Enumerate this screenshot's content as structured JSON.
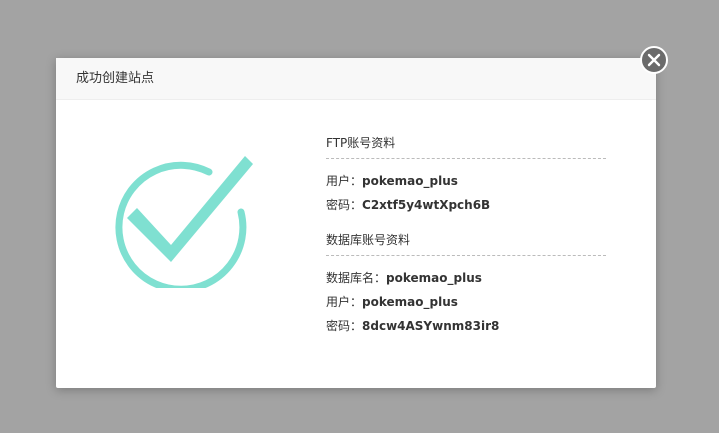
{
  "dialog": {
    "title": "成功创建站点",
    "close_icon": "close-icon"
  },
  "success_icon": {
    "name": "checkmark-circle-icon",
    "color": "#7fe0d1"
  },
  "ftp": {
    "section_title": "FTP账号资料",
    "user_label": "用户：",
    "user_value": "pokemao_plus",
    "password_label": "密码：",
    "password_value": "C2xtf5y4wtXpch6B"
  },
  "database": {
    "section_title": "数据库账号资料",
    "dbname_label": "数据库名：",
    "dbname_value": "pokemao_plus",
    "user_label": "用户：",
    "user_value": "pokemao_plus",
    "password_label": "密码：",
    "password_value": "8dcw4ASYwnm83ir8"
  }
}
